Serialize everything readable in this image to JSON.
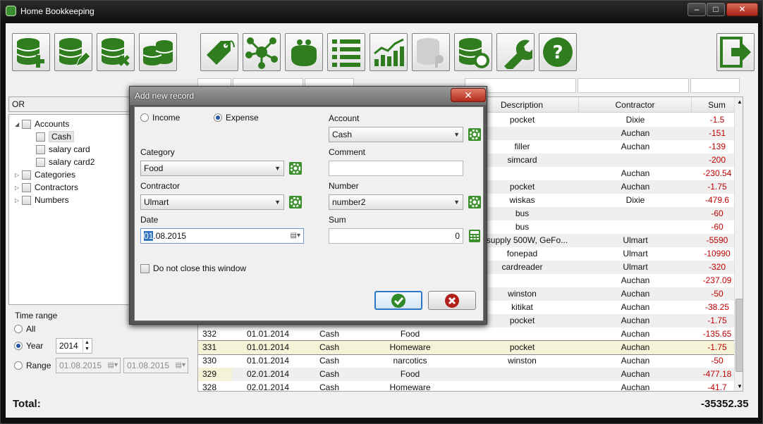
{
  "app": {
    "title": "Home Bookkeeping",
    "total_label": "Total:",
    "total_value": "-35352.35"
  },
  "left": {
    "filter_mode": "OR",
    "tree": [
      {
        "label": "Accounts",
        "level": 0,
        "expanded": true
      },
      {
        "label": "Cash",
        "level": 1,
        "selected": true
      },
      {
        "label": "salary card",
        "level": 1
      },
      {
        "label": "salary card2",
        "level": 1
      },
      {
        "label": "Categories",
        "level": 0
      },
      {
        "label": "Contractors",
        "level": 0
      },
      {
        "label": "Numbers",
        "level": 0
      }
    ]
  },
  "time": {
    "title": "Time range",
    "all": "All",
    "year": "Year",
    "year_value": "2014",
    "range": "Range",
    "range_from": "01.08.2015",
    "range_to": "01.08.2015"
  },
  "grid": {
    "headers": [
      "Description",
      "Contractor",
      "Sum"
    ],
    "rows": [
      {
        "desc": "pocket",
        "contractor": "Dixie",
        "sum": "-1.5"
      },
      {
        "desc": "",
        "contractor": "Auchan",
        "sum": "-151"
      },
      {
        "desc": "filler",
        "contractor": "Auchan",
        "sum": "-139"
      },
      {
        "desc": "simcard",
        "contractor": "",
        "sum": "-200"
      },
      {
        "desc": "",
        "contractor": "Auchan",
        "sum": "-230.54"
      },
      {
        "desc": "pocket",
        "contractor": "Auchan",
        "sum": "-1.75"
      },
      {
        "desc": "wiskas",
        "contractor": "Dixie",
        "sum": "-479.6"
      },
      {
        "desc": "bus",
        "contractor": "",
        "sum": "-60"
      },
      {
        "desc": "bus",
        "contractor": "",
        "sum": "-60"
      },
      {
        "desc": "er supply 500W, GeFo...",
        "contractor": "Ulmart",
        "sum": "-5590"
      },
      {
        "desc": "fonepad",
        "contractor": "Ulmart",
        "sum": "-10990"
      },
      {
        "desc": "cardreader",
        "contractor": "Ulmart",
        "sum": "-320"
      },
      {
        "desc": "",
        "contractor": "Auchan",
        "sum": "-237.09"
      },
      {
        "desc": "winston",
        "contractor": "Auchan",
        "sum": "-50"
      },
      {
        "desc": "kitikat",
        "contractor": "Auchan",
        "sum": "-38.25"
      },
      {
        "desc": "pocket",
        "contractor": "Auchan",
        "sum": "-1.75"
      }
    ],
    "full_rows": [
      {
        "num": "332",
        "date": "01.01.2014",
        "account": "Cash",
        "category": "Food",
        "desc": "",
        "contractor": "Auchan",
        "sum": "-135.65"
      },
      {
        "num": "331",
        "date": "01.01.2014",
        "account": "Cash",
        "category": "Homeware",
        "desc": "pocket",
        "contractor": "Auchan",
        "sum": "-1.75"
      },
      {
        "num": "330",
        "date": "01.01.2014",
        "account": "Cash",
        "category": "narcotics",
        "desc": "winston",
        "contractor": "Auchan",
        "sum": "-50"
      },
      {
        "num": "329",
        "date": "02.01.2014",
        "account": "Cash",
        "category": "Food",
        "desc": "",
        "contractor": "Auchan",
        "sum": "-477.18"
      },
      {
        "num": "328",
        "date": "02.01.2014",
        "account": "Cash",
        "category": "Homeware",
        "desc": "",
        "contractor": "Auchan",
        "sum": "-41.7"
      }
    ]
  },
  "dialog": {
    "title": "Add new record",
    "income": "Income",
    "expense": "Expense",
    "account_label": "Account",
    "account_value": "Cash",
    "category_label": "Category",
    "category_value": "Food",
    "comment_label": "Comment",
    "comment_value": "",
    "contractor_label": "Contractor",
    "contractor_value": "Ulmart",
    "number_label": "Number",
    "number_value": "number2",
    "date_label": "Date",
    "date_value": "01.08.2015",
    "sum_label": "Sum",
    "sum_value": "0",
    "keep_open": "Do not close this window"
  },
  "colors": {
    "green": "#2f7d1f",
    "money": "#c10000"
  }
}
